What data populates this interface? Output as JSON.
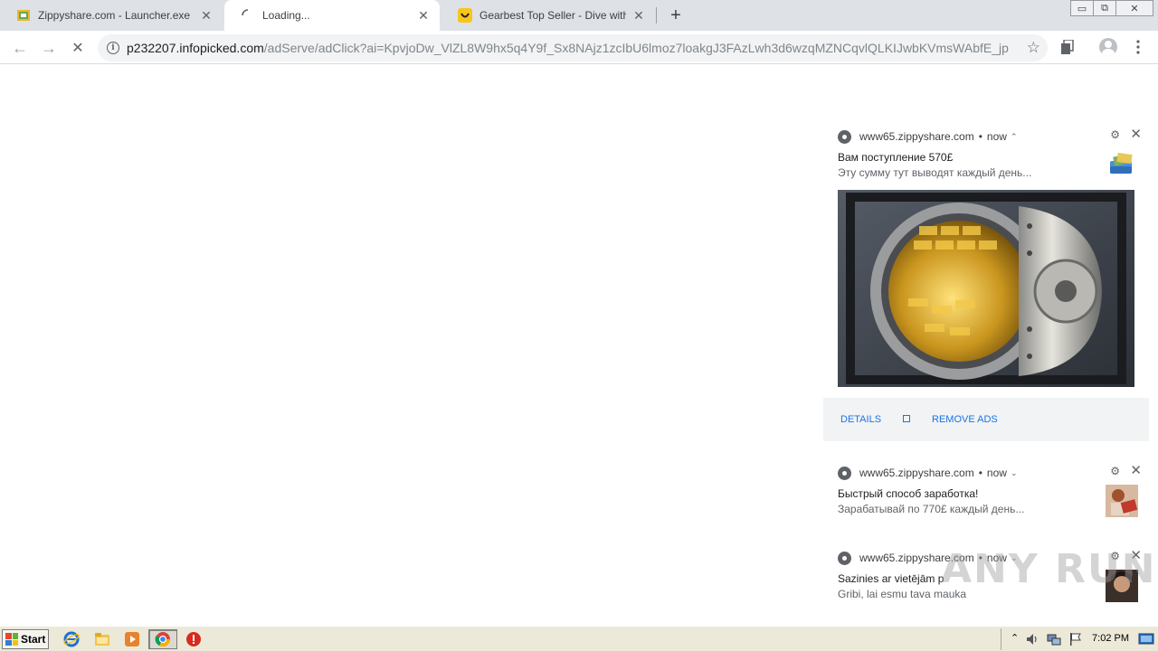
{
  "browser": {
    "tabs": [
      {
        "title": "Zippyshare.com - Launcher.exe",
        "close": "✕"
      },
      {
        "title": "Loading...",
        "close": "✕"
      },
      {
        "title": "Gearbest Top Seller - Dive with the C",
        "close": "✕"
      }
    ],
    "new_tab_label": "+",
    "window_controls": {
      "minimize": "▭",
      "restore": "⧉",
      "close": "✕"
    }
  },
  "toolbar": {
    "back": "←",
    "forward": "→",
    "stop": "✕",
    "info_icon": "i",
    "url_host": "p232207.infopicked.com",
    "url_path": "/adServe/adClick?ai=KpvjoDw_VlZL8W9hx5q4Y9f_Sx8NAjz1zcIbU6lmoz7loakgJ3FAzLwh3d6wzqMZNCqvlQLKIJwbKVmsWAbfE_jpFA...",
    "star": "☆"
  },
  "notifications": [
    {
      "source": "www65.zippyshare.com",
      "bullet": "•",
      "time": "now",
      "chevron": "⌃",
      "title": "Вам поступление 570£",
      "body": "Эту сумму тут выводят каждый день...",
      "actions": {
        "details": "DETAILS",
        "remove": "REMOVE ADS"
      }
    },
    {
      "source": "www65.zippyshare.com",
      "bullet": "•",
      "time": "now",
      "chevron": "⌄",
      "title": "Быстрый способ заработка!",
      "body": "Зарабатывай по 770£ каждый день..."
    },
    {
      "source": "www65.zippyshare.com",
      "bullet": "•",
      "time": "now",
      "chevron": "⌄",
      "title": "Sazinies ar vietējām p",
      "body": "Gribi, lai esmu tava mauka"
    }
  ],
  "watermark": "ANY RUN",
  "taskbar": {
    "start_label": "Start",
    "clock": "7:02 PM",
    "tray_expand": "⌃"
  },
  "icons": {
    "gear": "⚙",
    "close": "✕"
  }
}
